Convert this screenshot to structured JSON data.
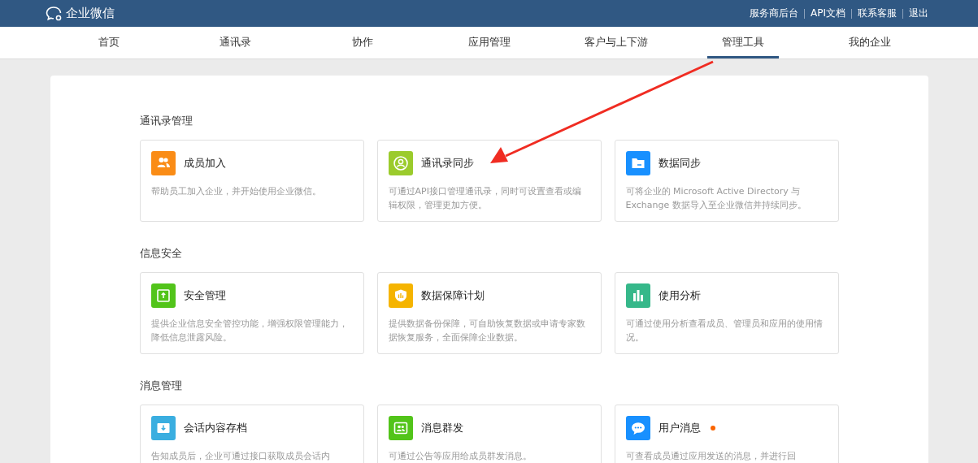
{
  "header": {
    "logo": "企业微信",
    "links": [
      "服务商后台",
      "API文档",
      "联系客服",
      "退出"
    ]
  },
  "tabs": [
    {
      "label": "首页",
      "selected": false
    },
    {
      "label": "通讯录",
      "selected": false
    },
    {
      "label": "协作",
      "selected": false
    },
    {
      "label": "应用管理",
      "selected": false
    },
    {
      "label": "客户与上下游",
      "selected": false
    },
    {
      "label": "管理工具",
      "selected": true
    },
    {
      "label": "我的企业",
      "selected": false
    }
  ],
  "sections": [
    {
      "title": "通讯录管理",
      "cards": [
        {
          "kind": "people",
          "color": "#fa8c16",
          "title": "成员加入",
          "description": "帮助员工加入企业，并开始使用企业微信。",
          "new_dot": false
        },
        {
          "kind": "contact",
          "color": "#9bcb2c",
          "title": "通讯录同步",
          "description": "可通过API接口管理通讯录，同时可设置查看或编辑权限，管理更加方便。",
          "new_dot": false
        },
        {
          "kind": "folder",
          "color": "#1890ff",
          "title": "数据同步",
          "description": "可将企业的 Microsoft Active Directory 与 Exchange 数据导入至企业微信并持续同步。",
          "new_dot": false
        }
      ]
    },
    {
      "title": "信息安全",
      "cards": [
        {
          "kind": "safe",
          "color": "#52c41a",
          "title": "安全管理",
          "description": "提供企业信息安全管控功能，增强权限管理能力，降低信息泄露风险。",
          "new_dot": false
        },
        {
          "kind": "shield",
          "color": "#f5b400",
          "title": "数据保障计划",
          "description": "提供数据备份保障，可自助恢复数据或申请专家数据恢复服务，全面保障企业数据。",
          "new_dot": false
        },
        {
          "kind": "chart",
          "color": "#36b88a",
          "title": "使用分析",
          "description": "可通过使用分析查看成员、管理员和应用的使用情况。",
          "new_dot": false
        }
      ]
    },
    {
      "title": "消息管理",
      "cards": [
        {
          "kind": "archive",
          "color": "#3aaee0",
          "title": "会话内容存档",
          "description": "告知成员后，企业可通过接口获取成员会话内",
          "new_dot": false
        },
        {
          "kind": "group",
          "color": "#52c41a",
          "title": "消息群发",
          "description": "可通过公告等应用给成员群发消息。",
          "new_dot": false
        },
        {
          "kind": "chat",
          "color": "#1890ff",
          "title": "用户消息",
          "description": "可查看成员通过应用发送的消息，并进行回",
          "new_dot": true
        }
      ]
    }
  ]
}
